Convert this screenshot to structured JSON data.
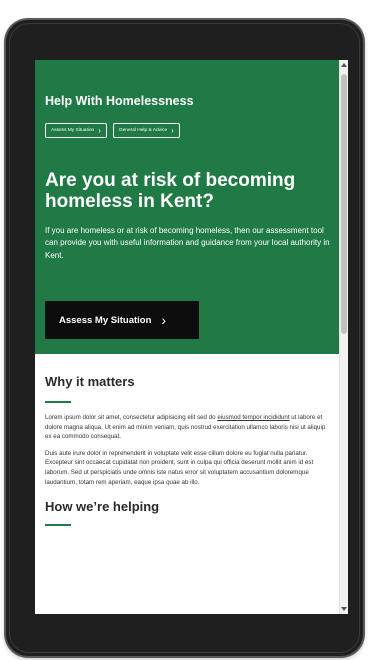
{
  "hero": {
    "site_title": "Help With Homelessness",
    "quick_links": [
      {
        "label": "Assess My Situation"
      },
      {
        "label": "General Help & Advice"
      }
    ],
    "heading": "Are you at risk of becoming homeless in Kent?",
    "body": "If you are homeless or at risk of becoming homeless, then our assessment tool can provide you with useful information and guidance from your local authority in Kent.",
    "cta_label": "Assess My Situation",
    "chevron_glyph": "›",
    "background_color": "#1f7a45"
  },
  "why_it_matters": {
    "heading": "Why it matters",
    "p1_start": "Lorem ipsum dolor sit amet, consectetur adipisicing elit sed do ",
    "p1_underlined": "eiusmod tempor incididunt",
    "p1_end": " ut labore et dolore magna aliqua. Ut enim ad minim veniam, quis nostrud exercitation ullamco laboris nisi ut aliquip ex ea commodo consequat.",
    "p2": "Duis aute irure dolor in reprehenderit in voluptate velit esse cillum dolore eu fugiat nulla pariatur. Excepteur sint occaecat cupidatat non proident, sunt in culpa qui officia deserunt mollit anim id est laborum. Sed ut perspiciatis unde omnis iste natus error sit voluptatem accusantium doloremque laudantium, totam rem aperiam, eaque ipsa quae ab illo."
  },
  "how_were_helping": {
    "heading": "How we’re helping"
  },
  "colors": {
    "accent_green": "#1f7a45",
    "button_black": "#0d0d0d",
    "device_frame": "#1f1f1f"
  },
  "scroll": {
    "position_fraction": 0
  }
}
